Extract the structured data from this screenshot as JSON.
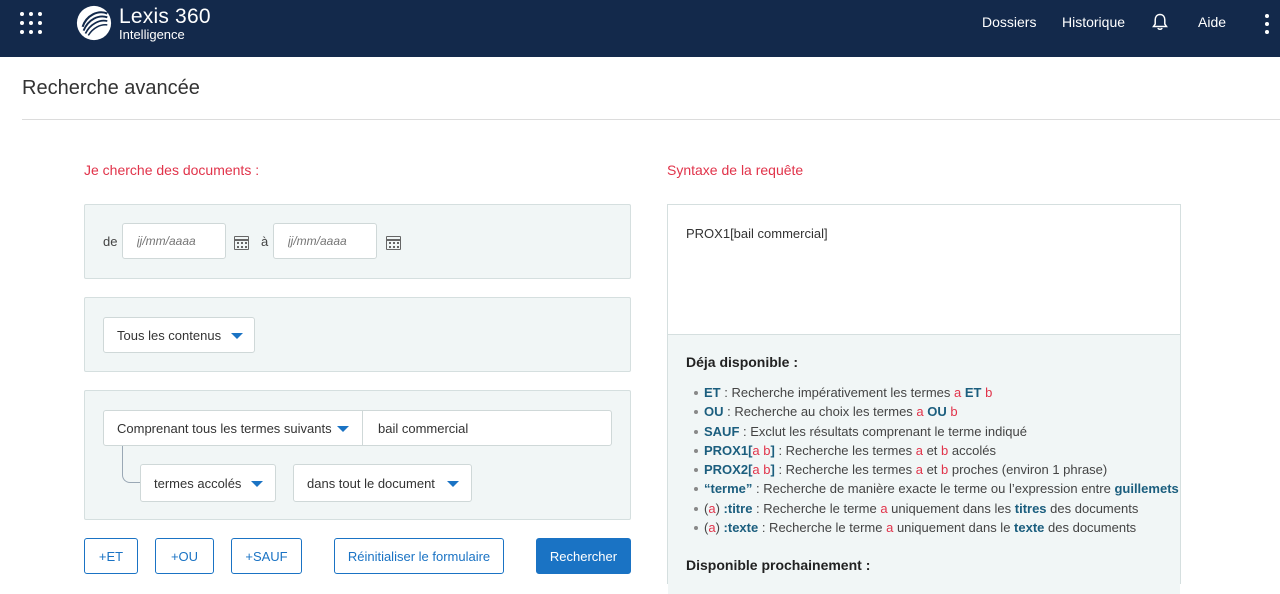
{
  "header": {
    "brand_name": "Lexis 360",
    "brand_sub": "Intelligence",
    "nav": [
      "Dossiers",
      "Historique",
      "Aide"
    ],
    "colors": {
      "bar": "#13294b",
      "accent": "#1a73c4",
      "heading": "#e1334a"
    }
  },
  "page": {
    "title": "Recherche avancée"
  },
  "form": {
    "heading": "Je cherche des documents :",
    "date": {
      "from_label": "de",
      "to_label": "à",
      "from_placeholder": "jj/mm/aaaa",
      "to_placeholder": "jj/mm/aaaa"
    },
    "content_select": "Tous les contenus",
    "criteria": {
      "mode_select": "Comprenant tous les termes suivants",
      "terms_value": "bail commercial",
      "proximity_select": "termes accolés",
      "scope_select": "dans tout le document"
    },
    "buttons": {
      "et": "+ET",
      "ou": "+OU",
      "sauf": "+SAUF",
      "reset": "Réinitialiser le formulaire",
      "search": "Rechercher"
    }
  },
  "syntax": {
    "heading": "Syntaxe de la requête",
    "query": "PROX1[bail commercial]",
    "available_heading": "Déja disponible :",
    "upcoming_heading": "Disponible prochainement :",
    "items": [
      {
        "kw": "ET",
        "t1": " : Recherche impérativement les termes ",
        "a": "a",
        "t2": " ",
        "kw2": "ET",
        "t3": " ",
        "b": "b",
        "t4": ""
      },
      {
        "kw": "OU",
        "t1": " : Recherche au choix les termes ",
        "a": "a",
        "t2": " ",
        "kw2": "OU",
        "t3": " ",
        "b": "b",
        "t4": ""
      },
      {
        "kw": "SAUF",
        "t1": " : Exclut les résultats comprenant le terme indiqué"
      },
      {
        "kw": "PROX1[",
        "a": "a b",
        "kw_end": "]",
        "t1": " : Recherche les termes ",
        "a2": "a",
        "t2": " et ",
        "b": "b",
        "t3": " accolés"
      },
      {
        "kw": "PROX2[",
        "a": "a b",
        "kw_end": "]",
        "t1": " : Recherche les termes ",
        "a2": "a",
        "t2": " et ",
        "b": "b",
        "t3": " proches (environ 1 phrase)"
      },
      {
        "kw": "“terme”",
        "t1": " : Recherche de manière exacte le terme ou l’expression entre ",
        "kw2": "guillemets"
      },
      {
        "p1": "(",
        "a": "a",
        "p2": ") ",
        "kw": ":titre",
        "t1": " : Recherche le terme ",
        "a2": "a",
        "t2": " uniquement dans les ",
        "kw2": "titres",
        "t3": " des documents"
      },
      {
        "p1": "(",
        "a": "a",
        "p2": ") ",
        "kw": ":texte",
        "t1": " : Recherche le terme ",
        "a2": "a",
        "t2": " uniquement dans le ",
        "kw2": "texte",
        "t3": " des documents"
      }
    ]
  }
}
